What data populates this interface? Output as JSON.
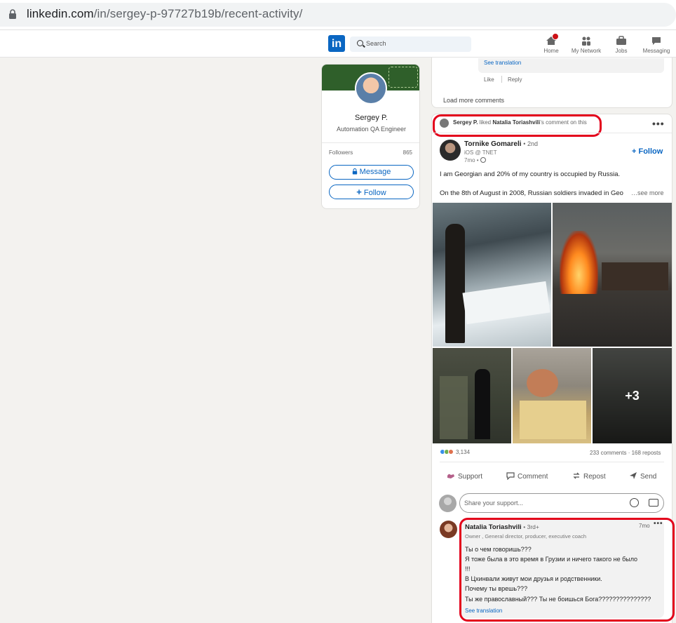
{
  "browser": {
    "url_host": "linkedin.com",
    "url_path": "/in/sergey-p-97727b19b/recent-activity/"
  },
  "nav": {
    "logo": "in",
    "search_placeholder": "Search",
    "items": [
      {
        "label": "Home",
        "icon": "home-icon"
      },
      {
        "label": "My Network",
        "icon": "network-icon"
      },
      {
        "label": "Jobs",
        "icon": "briefcase-icon"
      },
      {
        "label": "Messaging",
        "icon": "messaging-icon"
      }
    ]
  },
  "profile": {
    "name": "Sergey P.",
    "title": "Automation QA Engineer",
    "followers_label": "Followers",
    "followers_count": "865",
    "message_label": "Message",
    "follow_label": "Follow"
  },
  "prev_post": {
    "see_translation": "See translation",
    "like": "Like",
    "reply": "Reply",
    "load_more": "Load more comments"
  },
  "post": {
    "activity": {
      "actor": "Sergey P.",
      "verb": "liked",
      "target": "Natalia Toriashvili",
      "suffix": "’s comment on this"
    },
    "author": {
      "name": "Tornike Gomareli",
      "degree": "• 2nd",
      "subtitle": "iOS @ TNET",
      "time": "7mo •"
    },
    "follow_label": "+ Follow",
    "text_line1": "I am Georgian and 20% of my country is occupied by Russia.",
    "text_line2": "On the 8th of August in 2008, Russian soldiers invaded in Geo",
    "see_more": "…see more",
    "more_images": "+3",
    "reactions_count": "3,134",
    "counts": "233 comments · 168 reposts",
    "actions": {
      "support": "Support",
      "comment": "Comment",
      "repost": "Repost",
      "send": "Send"
    },
    "comment_placeholder": "Share your support..."
  },
  "comment": {
    "name": "Natalia Toriashvili",
    "degree": "• 3rd+",
    "headline": "Owner , General director, producer, executive coach",
    "time": "7mo",
    "lines": [
      "Ты о чем говоришь???",
      "Я тоже была в это время в Грузии и ничего такого не было",
      "!!!",
      "В Цхинвали живут мои друзья и родственники.",
      "Почему ты врешь???",
      "Ты же православный??? Ты не боишься Бога???????????????"
    ],
    "see_translation": "See translation"
  },
  "colors": {
    "accent": "#0a66c2",
    "highlight": "#e3001b",
    "background": "#f3f2ef"
  }
}
